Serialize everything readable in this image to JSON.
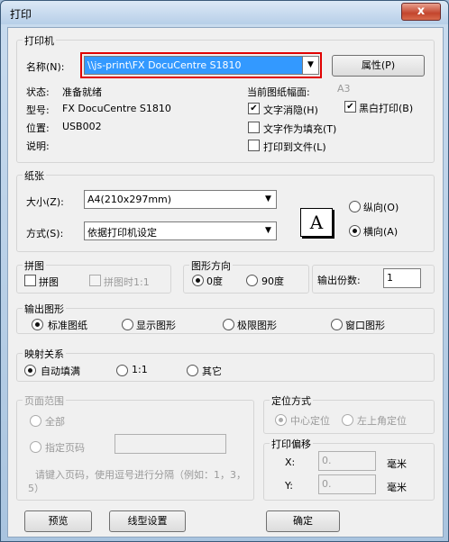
{
  "window": {
    "title": "打印",
    "close_glyph": "x"
  },
  "printer": {
    "legend": "打印机",
    "name_label": "名称(N):",
    "name_value": "\\\\js-print\\FX DocuCentre S1810",
    "properties_button": "属性(P)",
    "status_label": "状态:",
    "status_value": "准备就绪",
    "type_label": "型号:",
    "type_value": "FX DocuCentre S1810",
    "location_label": "位置:",
    "location_value": "USB002",
    "comment_label": "说明:",
    "current_paper_label": "当前图纸幅面:",
    "current_paper_value": "A3",
    "text_erase": "文字消隐(H)",
    "bw_print": "黑白打印(B)",
    "text_as_fill": "文字作为填充(T)",
    "print_to_file": "打印到文件(L)"
  },
  "paper": {
    "legend": "纸张",
    "size_label": "大小(Z):",
    "size_value": "A4(210x297mm)",
    "mode_label": "方式(S):",
    "mode_value": "依据打印机设定",
    "portrait": "纵向(O)",
    "landscape": "横向(A)",
    "orientation_icon_letter": "A"
  },
  "tiling": {
    "legend": "拼图",
    "tile": "拼图",
    "tile_ratio": "拼图时1:1"
  },
  "direction": {
    "legend": "图形方向",
    "deg0": "0度",
    "deg90": "90度"
  },
  "copies": {
    "label": "输出份数:",
    "value": "1"
  },
  "output": {
    "legend": "输出图形",
    "options": [
      "标准图纸",
      "显示图形",
      "极限图形",
      "窗口图形"
    ]
  },
  "mapping": {
    "legend": "映射关系",
    "options": [
      "自动填满",
      "1:1",
      "其它"
    ]
  },
  "page_range": {
    "legend": "页面范围",
    "all": "全部",
    "specified": "指定页码",
    "hint_line1": "请键入页码，使用逗号进行分隔（例如：1，3，",
    "hint_line2": "5）"
  },
  "position": {
    "legend": "定位方式",
    "center": "中心定位",
    "top_left": "左上角定位"
  },
  "offset": {
    "legend": "打印偏移",
    "x_label": "X:",
    "x_value": "0.",
    "x_unit": "毫米",
    "y_label": "Y:",
    "y_value": "0.",
    "y_unit": "毫米"
  },
  "buttons": {
    "preview": "预览",
    "line_settings": "线型设置",
    "ok": "确定"
  },
  "icons": {
    "dropdown": "dropdown-arrow-icon",
    "checkmark": "checkmark-icon"
  }
}
